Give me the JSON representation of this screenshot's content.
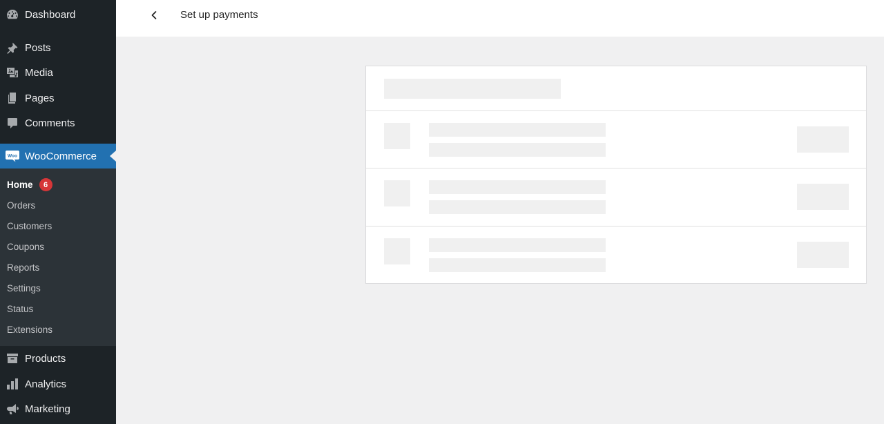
{
  "sidebar": {
    "top_items": [
      {
        "label": "Dashboard",
        "icon": "dashboard-icon"
      },
      {
        "label": "Posts",
        "icon": "pin-icon"
      },
      {
        "label": "Media",
        "icon": "media-icon"
      },
      {
        "label": "Pages",
        "icon": "pages-icon"
      },
      {
        "label": "Comments",
        "icon": "comment-icon"
      }
    ],
    "current": {
      "label": "WooCommerce",
      "icon": "woo-icon",
      "icon_text": "Woo"
    },
    "submenu": [
      {
        "label": "Home",
        "badge": "6"
      },
      {
        "label": "Orders"
      },
      {
        "label": "Customers"
      },
      {
        "label": "Coupons"
      },
      {
        "label": "Reports"
      },
      {
        "label": "Settings"
      },
      {
        "label": "Status"
      },
      {
        "label": "Extensions"
      }
    ],
    "bottom_items": [
      {
        "label": "Products",
        "icon": "archive-icon"
      },
      {
        "label": "Analytics",
        "icon": "bar-chart-icon"
      },
      {
        "label": "Marketing",
        "icon": "megaphone-icon"
      }
    ]
  },
  "header": {
    "title": "Set up payments",
    "back_icon": "chevron-left-icon"
  },
  "colors": {
    "sidebar_bg": "#1d2327",
    "submenu_bg": "#2c3338",
    "accent": "#2271b1",
    "badge": "#d63638",
    "page_bg": "#f0f0f1",
    "placeholder": "#f0f0f0"
  }
}
